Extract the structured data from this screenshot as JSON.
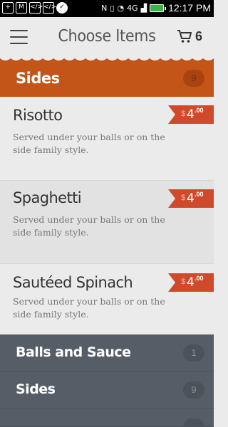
{
  "status_bar": {
    "left_icons": [
      "add-icon",
      "mail-icon",
      "code-icon",
      "code-icon",
      "check-icon"
    ],
    "network_label": "4G",
    "time": "12:17 PM"
  },
  "header": {
    "title": "Choose Items",
    "cart_count": "6"
  },
  "section": {
    "title": "Sides",
    "count": "9",
    "color": "#c45518"
  },
  "items": [
    {
      "name": "Risotto",
      "description": "Served under your balls or on the side family style.",
      "currency": "$",
      "price": "4",
      "cents": ".00"
    },
    {
      "name": "Spaghetti",
      "description": "Served under your balls or on the side family style.",
      "currency": "$",
      "price": "4",
      "cents": ".00"
    },
    {
      "name": "Sautéed Spinach",
      "description": "Served under your balls or on the side family style.",
      "currency": "$",
      "price": "4",
      "cents": ".00"
    }
  ],
  "categories": [
    {
      "label": "Balls and Sauce",
      "count": "1"
    },
    {
      "label": "Sides",
      "count": "9"
    }
  ]
}
